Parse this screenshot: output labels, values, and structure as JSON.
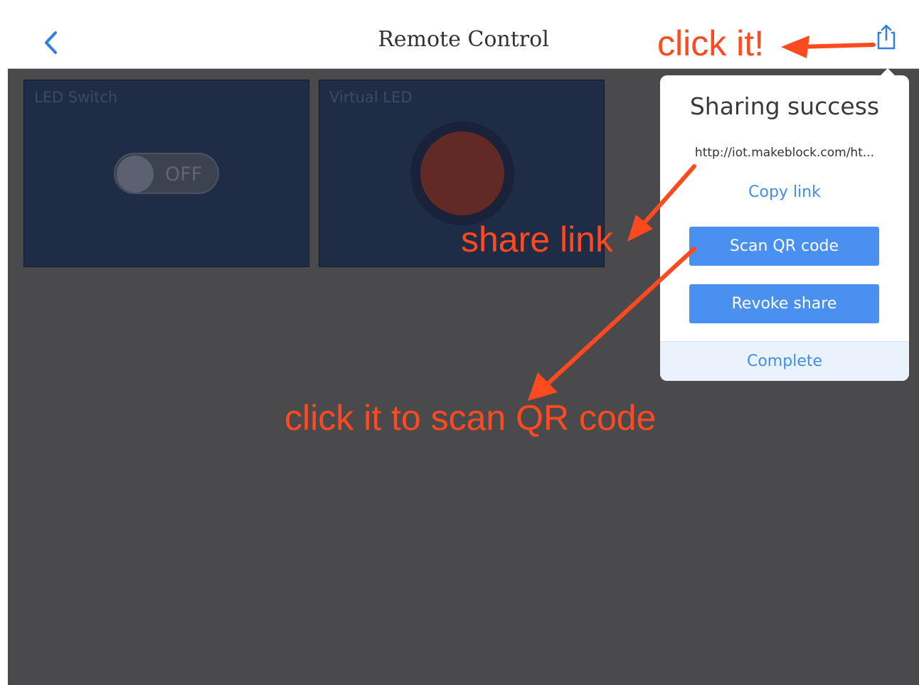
{
  "header": {
    "title": "Remote Control",
    "back_icon": "chevron-left-icon",
    "share_icon": "share-icon"
  },
  "widgets": [
    {
      "label": "LED Switch",
      "type": "switch",
      "state": "OFF"
    },
    {
      "label": "Virtual LED",
      "type": "led"
    }
  ],
  "popup": {
    "title": "Sharing success",
    "link": "http://iot.makeblock.com/ht...",
    "copy_label": "Copy link",
    "scan_label": "Scan QR code",
    "revoke_label": "Revoke share",
    "complete_label": "Complete"
  },
  "annotations": {
    "click_it": "click it!",
    "share_link": "share link",
    "scan_hint": "click it to scan QR code"
  },
  "colors": {
    "accent": "#4a90f0",
    "annotation": "#ff4a1f",
    "overlay": "#4a4a4d"
  }
}
